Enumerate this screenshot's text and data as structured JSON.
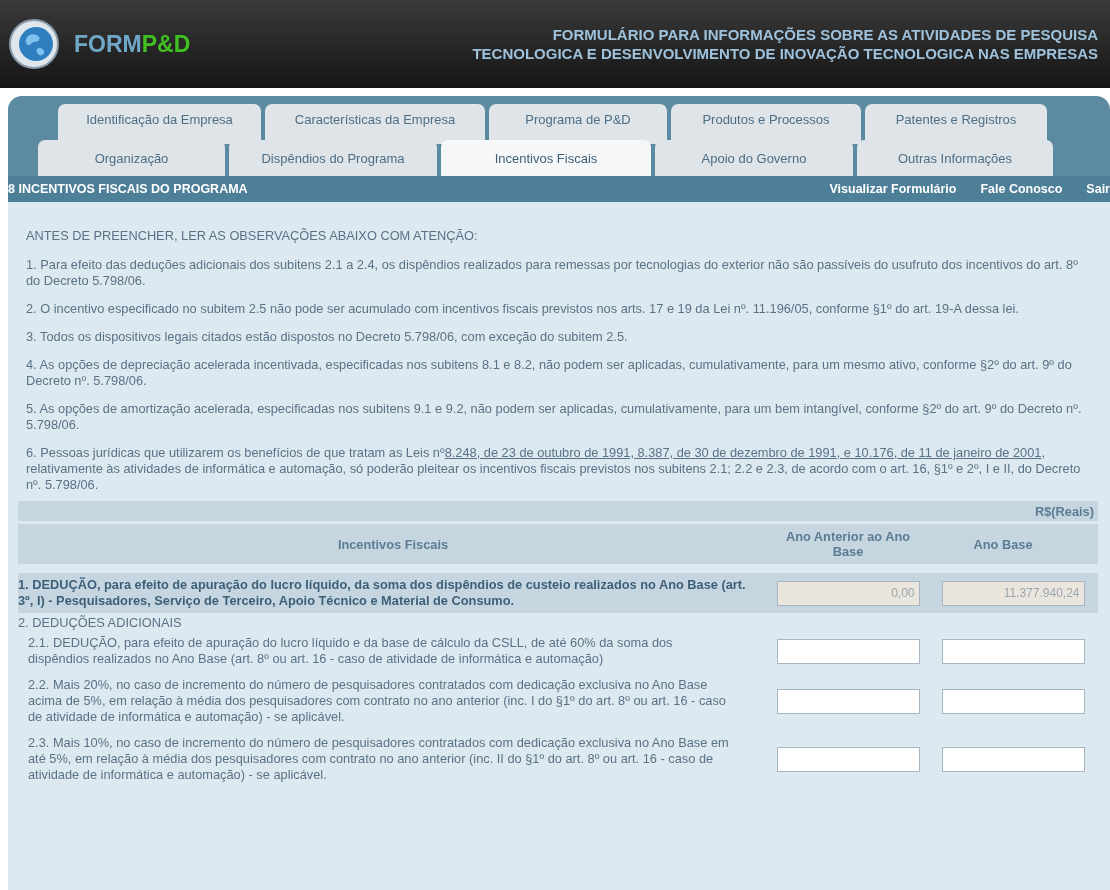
{
  "header": {
    "logo": {
      "part1": "FORM",
      "part2": "P&D"
    },
    "title_lines": [
      "FORMULÁRIO PARA INFORMAÇÕES SOBRE AS ATIVIDADES DE PESQUISA",
      "TECNOLOGICA E DESENVOLVIMENTO DE INOVAÇÃO TECNOLOGICA NAS EMPRESAS"
    ]
  },
  "tab_rows": [
    [
      {
        "label": "Identificação da Empresa",
        "selected": false
      },
      {
        "label": "Características da Empresa",
        "selected": false
      },
      {
        "label": "Programa de P&D",
        "selected": false
      },
      {
        "label": "Produtos e Processos",
        "selected": false
      },
      {
        "label": "Patentes e Registros",
        "selected": false
      }
    ],
    [
      {
        "label": "Organização",
        "selected": false
      },
      {
        "label": "Dispêndios do Programa",
        "selected": false
      },
      {
        "label": "Incentivos Fiscais",
        "selected": true
      },
      {
        "label": "Apoio do Governo",
        "selected": false
      },
      {
        "label": "Outras Informações",
        "selected": false
      }
    ]
  ],
  "section_bar": {
    "title": "8 INCENTIVOS FISCAIS DO PROGRAMA",
    "links": [
      "Visualizar Formulário",
      "Fale Conosco",
      "Sair"
    ]
  },
  "notice": "ANTES DE PREENCHER, LER AS OBSERVAÇÕES ABAIXO COM ATENÇÃO:",
  "notes": [
    {
      "text": "1. Para efeito das deduções adicionais dos subitens 2.1 a 2.4, os dispêndios realizados para remessas por tecnologias do exterior não são passíveis do usufruto dos incentivos do art. 8º do Decreto 5.798/06."
    },
    {
      "text": "2. O incentivo especificado no subitem 2.5 não pode ser acumulado com incentivos fiscais previstos nos arts. 17 e 19 da Lei nº. 11.196/05, conforme §1º do art. 19-A dessa lei."
    },
    {
      "text": "3. Todos os dispositivos legais citados estão dispostos no Decreto 5.798/06, com exceção do subitem 2.5."
    },
    {
      "text": "4. As opções de depreciação acelerada incentivada, especificadas nos subitens 8.1 e 8.2, não podem ser aplicadas, cumulativamente, para um mesmo ativo, conforme §2º do art. 9º do Decreto nº. 5.798/06."
    },
    {
      "text": "5. As opções de amortização acelerada, especificadas nos subitens 9.1 e 9.2, não podem ser aplicadas, cumulativamente, para um bem intangível, conforme §2º do art. 9º do Decreto nº. 5.798/06."
    },
    {
      "text": "6. Pessoas jurídicas que utilizarem os benefícios de que tratam as Leis nº",
      "link": "8.248, de 23 de outubro de 1991, 8.387, de 30 de dezembro de 1991, e 10.176, de 11 de janeiro de 2001",
      "after": ", relativamente às atividades de informática e automação, só poderão pleitear os incentivos fiscais previstos nos subitens 2.1; 2.2 e 2.3, de acordo com o art. 16, §1º e 2º, I e II, do Decreto nº. 5.798/06."
    }
  ],
  "table": {
    "unit": "R$(Reais)",
    "columns": [
      "Incentivos Fiscais",
      "Ano Anterior ao Ano Base",
      "Ano Base"
    ],
    "rows": [
      {
        "kind": "total",
        "label": "1. DEDUÇÃO, para efeito de apuração do lucro líquido, da soma dos dispêndios de custeio realizados no Ano Base (art. 3º, I) - Pesquisadores, Serviço de Terceiro, Apoio Técnico e Material de Consumo.",
        "values": [
          "0,00",
          "11.377.940,24"
        ]
      },
      {
        "kind": "group",
        "label": "2. DEDUÇÕES ADICIONAIS"
      },
      {
        "kind": "item",
        "label": "2.1. DEDUÇÃO, para efeito de apuração do lucro líquido e da base de cálculo da CSLL, de até 60% da soma dos dispêndios realizados no Ano Base (art. 8º ou art. 16 - caso de atividade de informática e automação)"
      },
      {
        "kind": "item",
        "label": "2.2. Mais 20%, no caso de incremento do número de pesquisadores contratados com dedicação exclusiva no Ano Base acima de 5%, em relação à média dos pesquisadores com contrato no ano anterior (inc. I do §1º do art. 8º ou art. 16 - caso de atividade de informática e automação) - se aplicável."
      },
      {
        "kind": "item",
        "label": "2.3. Mais 10%, no caso de incremento do número de pesquisadores contratados com dedicação exclusiva no Ano Base em até 5%, em relação à média dos pesquisadores com contrato no ano anterior (inc. II do §1º do art. 8º ou art. 16 - caso de atividade de informática e automação) - se aplicável."
      }
    ]
  }
}
